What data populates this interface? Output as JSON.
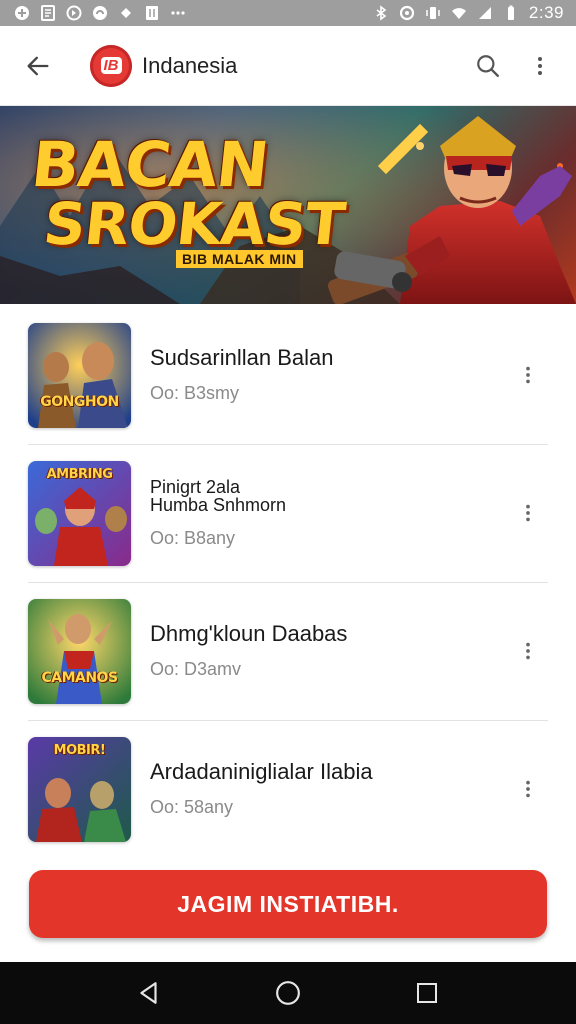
{
  "status_bar": {
    "time": "2:39",
    "left_icons": [
      "vpn-icon",
      "notification-icon",
      "app-icon",
      "app-icon-2",
      "dot-icon",
      "sim-icon",
      "more-notifications-icon"
    ],
    "right_icons": [
      "bluetooth-icon",
      "sync-icon",
      "vibrate-icon",
      "wifi-icon",
      "signal-icon",
      "battery-icon"
    ]
  },
  "app_bar": {
    "back_icon": "arrow-left-icon",
    "logo_text": "IB",
    "title": "Indanesia",
    "search_icon": "search-icon",
    "menu_icon": "more-vert-icon"
  },
  "banner": {
    "title_line1": "BACAN",
    "title_line2": "SROKAST",
    "subtitle": "BIB MALAK MIN"
  },
  "items": [
    {
      "title": "Sudsarinllan Balan",
      "meta": "Oo: B3smy",
      "thumb_label": "GONGHON"
    },
    {
      "title_line1": "Pinigrt 2ala",
      "title_line2": "Humba Snhmorn",
      "meta": "Oo: B8any",
      "thumb_label": "AMBRING"
    },
    {
      "title": "Dhmg'kloun Daabas",
      "meta": "Oo: D3amv",
      "thumb_label": "CAMANOS"
    },
    {
      "title": "Ardadaniniglialar Ilabia",
      "meta": "Oo: 58any",
      "thumb_label": "MOBIR!"
    }
  ],
  "cta": {
    "label": "JAGIM INSTIATIBH."
  },
  "nav": {
    "back_icon": "nav-back-icon",
    "home_icon": "nav-home-icon",
    "recents_icon": "nav-recents-icon"
  },
  "colors": {
    "accent": "#e3352a",
    "status_bar": "#9e9e9e",
    "nav_bar": "#0b0b0b"
  }
}
